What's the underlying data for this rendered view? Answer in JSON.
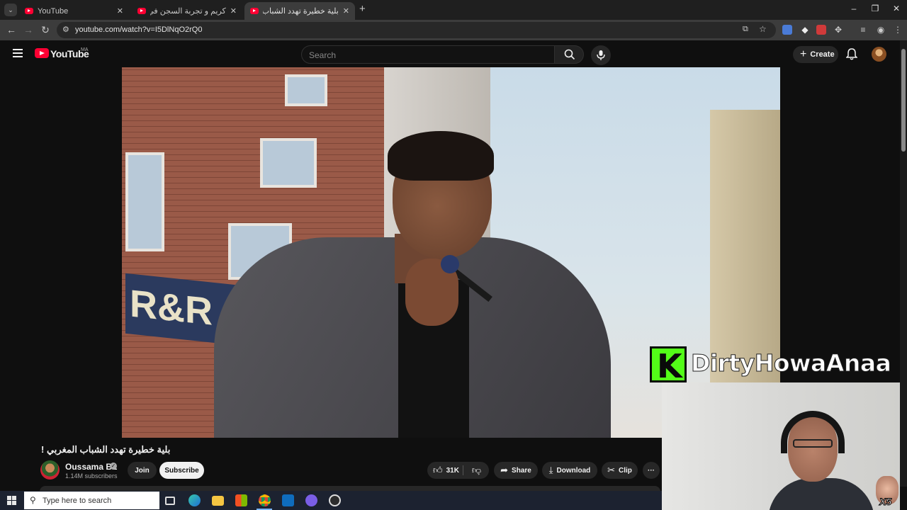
{
  "browser": {
    "tabs": [
      {
        "title": "YouTube",
        "active": false
      },
      {
        "title": "كريم و تجربة السجن في أمريكا - ...",
        "active": false
      },
      {
        "title": "بلية خطيرة تهدد الشباب المغربي",
        "active": true
      }
    ],
    "new_tab": "+",
    "url": "youtube.com/watch?v=I5DlNqO2rQ0",
    "window_controls": {
      "minimize": "–",
      "maximize": "❐",
      "close": "✕"
    }
  },
  "youtube": {
    "logo_text": "YouTube",
    "region": "MA",
    "search_placeholder": "Search",
    "create_label": "Create"
  },
  "video": {
    "title": "بلية خطيرة تهدد الشباب المغربي !",
    "channel_name": "Oussama BL",
    "subscribers": "1.14M subscribers",
    "join_label": "Join",
    "subscribe_label": "Subscribe",
    "likes": "31K",
    "share_label": "Share",
    "download_label": "Download",
    "clip_label": "Clip",
    "more_label": "···",
    "shop_sign": "R&R"
  },
  "overlay": {
    "kick_letter": "K",
    "streamer_name": "DirtyHowaAnaa",
    "emote_badge": "X5"
  },
  "taskbar": {
    "search_placeholder": "Type here to search"
  },
  "colors": {
    "youtube_red": "#ff0033",
    "kick_green": "#53fc18",
    "background": "#0f0f0f"
  }
}
